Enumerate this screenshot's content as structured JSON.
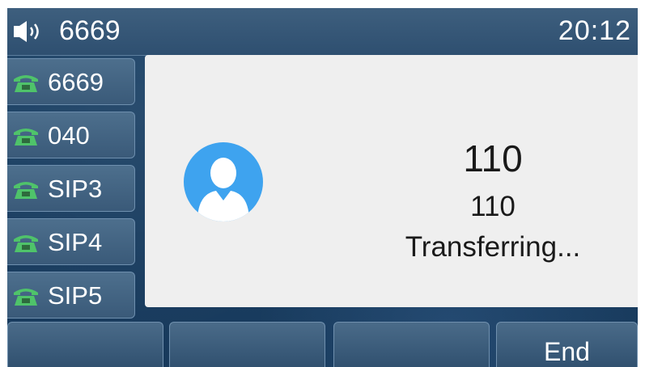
{
  "status_bar": {
    "speaker_icon": "speaker-volume-icon",
    "account": "6669",
    "time": "20:12"
  },
  "line_keys": [
    {
      "label": "6669",
      "icon": "phone-icon"
    },
    {
      "label": "040",
      "icon": "phone-icon"
    },
    {
      "label": "SIP3",
      "icon": "phone-icon"
    },
    {
      "label": "SIP4",
      "icon": "phone-icon"
    },
    {
      "label": "SIP5",
      "icon": "phone-icon"
    }
  ],
  "call": {
    "name": "110",
    "number": "110",
    "status": "Transferring..."
  },
  "softkeys": [
    {
      "label": ""
    },
    {
      "label": ""
    },
    {
      "label": ""
    },
    {
      "label": "End"
    }
  ],
  "colors": {
    "accent_green": "#4fc36a",
    "avatar_blue": "#3ea3ef"
  }
}
